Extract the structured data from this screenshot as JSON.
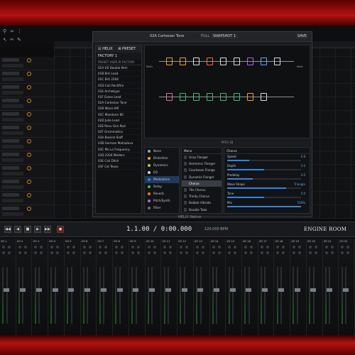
{
  "preset_panel": {
    "tab_a": "☰ HELIX",
    "tab_b": "⊞ PRESET",
    "setlist": "FACTORY 1",
    "sub": "PRESET  USER  IR  FACTORY",
    "presets": [
      "01A US Double Nrm",
      "01B Brit Lead",
      "01C Brit 2204",
      "01D Cali Rectifire",
      "01E Archetype",
      "01F Essex Lead",
      "02A Cartesian Tone",
      "02B Wave Hifi",
      "02C Mandarin 80",
      "02D Julia Lead",
      "02E Revv Gen Red",
      "02F Grammatico",
      "03A Bassist Slaff",
      "03B German Mahadeva",
      "03C Mo Lo Frequency",
      "03D 2204 Modern",
      "03E Cali Ditch",
      "03F Cal Texas"
    ]
  },
  "title_bar": {
    "preset": "02A Cartesian Tone",
    "mode": "FULL",
    "snapshot": "SNAPSHOT 1",
    "save": "SAVE"
  },
  "path": {
    "input": "Multi",
    "output": "Multi"
  },
  "section_header": "PATH 1B",
  "categories": [
    {
      "label": "None",
      "color": "#9aa3ad"
    },
    {
      "label": "Distortion",
      "color": "#e8a33a"
    },
    {
      "label": "Dynamics",
      "color": "#c9c22f"
    },
    {
      "label": "EQ",
      "color": "#cfd3d8"
    },
    {
      "label": "Modulation",
      "color": "#2d86e6",
      "selected": true
    },
    {
      "label": "Delay",
      "color": "#36c26b"
    },
    {
      "label": "Reverb",
      "color": "#ff6d2e"
    },
    {
      "label": "Pitch/Synth",
      "color": "#b564e6"
    },
    {
      "label": "Filter",
      "color": "#8b6d3c"
    }
  ],
  "models_header": "Mono",
  "models": [
    {
      "label": "Gray Flanger"
    },
    {
      "label": "Harmonic Flanger"
    },
    {
      "label": "Courtesan Flange"
    },
    {
      "label": "Dynamix Flanger"
    },
    {
      "label": "Chorus",
      "selected": true
    },
    {
      "label": "70s Chorus"
    },
    {
      "label": "Trinity Chorus"
    },
    {
      "label": "Bubble Vibrato"
    },
    {
      "label": "Double Take"
    }
  ],
  "params_header": "Chorus",
  "params": [
    {
      "label": "Speed",
      "value": "0.8",
      "level": 0.3
    },
    {
      "label": "Depth",
      "value": "5.0",
      "level": 0.5
    },
    {
      "label": "Predelay",
      "value": "3.0",
      "level": 0.35
    },
    {
      "label": "Wave Shape",
      "value": "Triangle",
      "level": 0.8
    },
    {
      "label": "Tone",
      "value": "5.0",
      "level": 0.5
    },
    {
      "label": "Mix",
      "value": "100%",
      "level": 1.0
    }
  ],
  "plug_footer": "HELIX Native",
  "transport": {
    "timecode": "1.1.00 / 0:00.000",
    "bpm": "120.000 BPM",
    "logo": "ENGINE ROOM"
  },
  "mixer_strips": [
    "VO 1",
    "VO 2",
    "VO 3",
    "VO 4",
    "VO 5",
    "VO 6",
    "VO 7",
    "VO 8",
    "VO 9",
    "VO 10",
    "VO 11",
    "VO 12",
    "VO 13",
    "VO 14",
    "VO 15",
    "VO 16",
    "VO 17",
    "VO 18",
    "VO 19",
    "VO 20",
    "VO 21",
    "VO 22"
  ]
}
